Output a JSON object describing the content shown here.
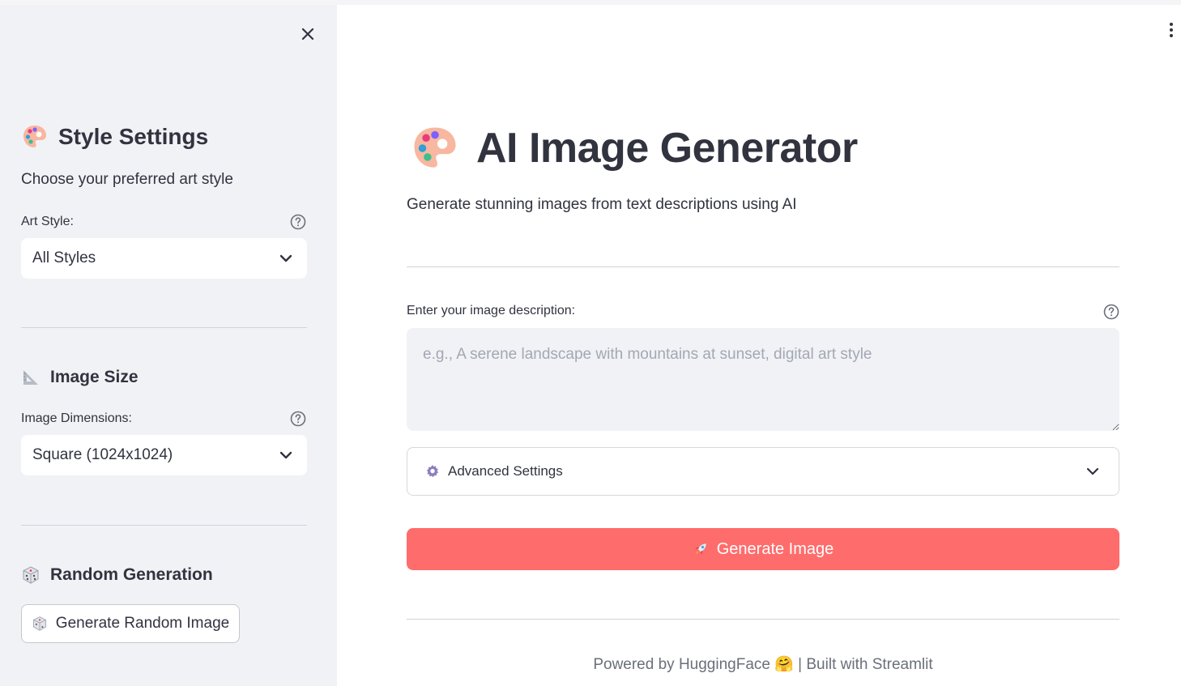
{
  "sidebar": {
    "close_label": "✕",
    "style_settings": {
      "icon": "palette-icon",
      "emoji": "🎨",
      "title": "Style Settings",
      "description": "Choose your preferred art style",
      "field_label": "Art Style:",
      "selected": "All Styles"
    },
    "image_size": {
      "icon": "triangular-ruler-icon",
      "emoji": "📐",
      "title": "Image Size",
      "field_label": "Image Dimensions:",
      "selected": "Square (1024x1024)"
    },
    "random_generation": {
      "icon": "dice-icon",
      "emoji": "🎲",
      "title": "Random Generation",
      "button_label": "Generate Random Image"
    }
  },
  "main": {
    "title_emoji": "🎨",
    "title": "AI Image Generator",
    "subtitle": "Generate stunning images from text descriptions using AI",
    "description_label": "Enter your image description:",
    "description_placeholder": "e.g., A serene landscape with mountains at sunset, digital art style",
    "description_value": "",
    "advanced_emoji": "⚙️",
    "advanced_label": "Advanced Settings",
    "generate_emoji": "🚀",
    "generate_label": "Generate Image",
    "footer": "Powered by HuggingFace 🤗 | Built with Streamlit"
  },
  "colors": {
    "sidebar_bg": "#f0f2f6",
    "primary": "#ff6c6c",
    "text": "#31333f",
    "muted": "#6b6f7a"
  }
}
